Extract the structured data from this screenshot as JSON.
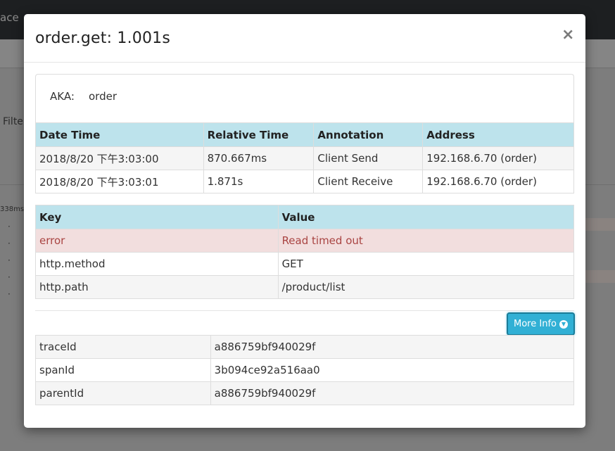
{
  "background": {
    "nav_text": "ace",
    "nav_text2": "... .",
    "filter_text": "Filte",
    "duration_text": "338ms"
  },
  "modal": {
    "title": "order.get: 1.001s",
    "close_icon": "close-icon",
    "aka_label": "AKA:",
    "aka_value": "order"
  },
  "annotations": {
    "headers": [
      "Date Time",
      "Relative Time",
      "Annotation",
      "Address"
    ],
    "rows": [
      [
        "2018/8/20 下午3:03:00",
        "870.667ms",
        "Client Send",
        "192.168.6.70 (order)"
      ],
      [
        "2018/8/20 下午3:03:01",
        "1.871s",
        "Client Receive",
        "192.168.6.70 (order)"
      ]
    ]
  },
  "tags": {
    "headers": [
      "Key",
      "Value"
    ],
    "rows": [
      [
        "error",
        "Read timed out"
      ],
      [
        "http.method",
        "GET"
      ],
      [
        "http.path",
        "/product/list"
      ]
    ]
  },
  "more_info": {
    "label": "More Info",
    "icon": "chevron-circle-down-icon"
  },
  "ids": {
    "rows": [
      [
        "traceId",
        "a886759bf940029f"
      ],
      [
        "spanId",
        "3b094ce92a516aa0"
      ],
      [
        "parentId",
        "a886759bf940029f"
      ]
    ]
  },
  "colors": {
    "header_bg": "#bde3ec",
    "error_bg": "#f2dede",
    "error_text": "#a94442",
    "button_bg": "#31b0d5"
  }
}
